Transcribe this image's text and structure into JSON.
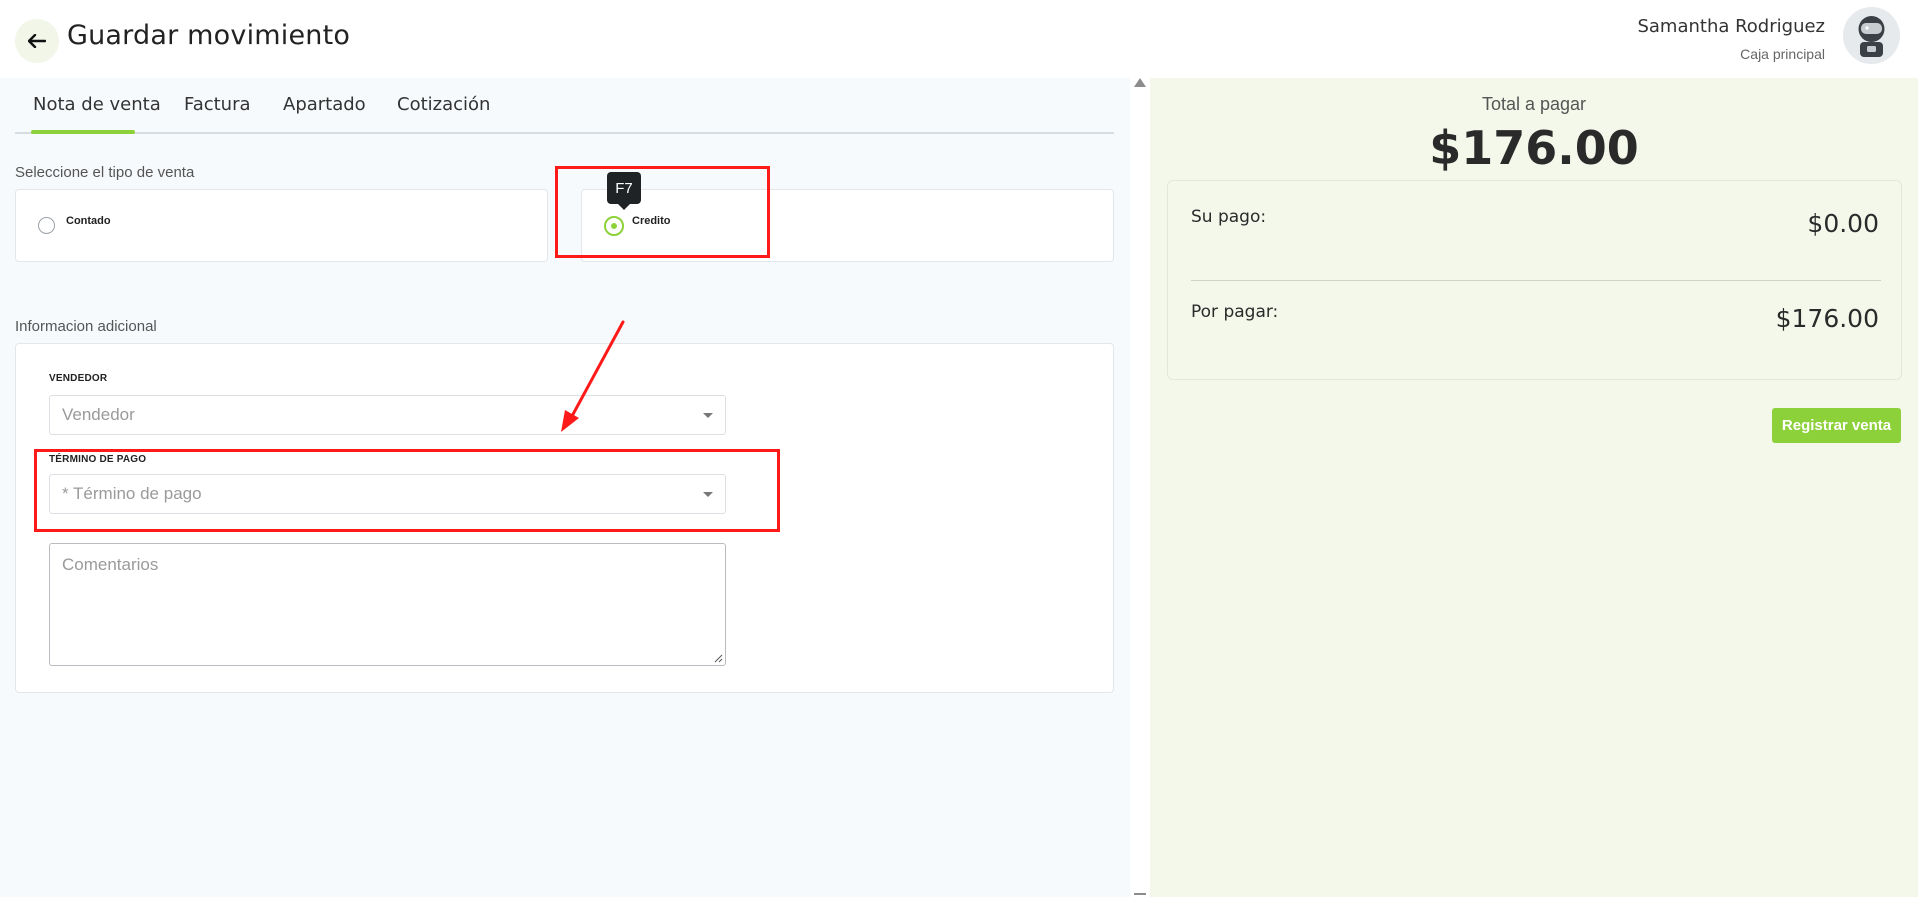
{
  "header": {
    "title": "Guardar movimiento",
    "user_name": "Samantha Rodriguez",
    "user_role": "Caja principal"
  },
  "tabs": [
    {
      "label": "Nota de venta",
      "active": true
    },
    {
      "label": "Factura",
      "active": false
    },
    {
      "label": "Apartado",
      "active": false
    },
    {
      "label": "Cotización",
      "active": false
    }
  ],
  "sale_type": {
    "section_label": "Seleccione el tipo de venta",
    "options": [
      {
        "label": "Contado",
        "selected": false
      },
      {
        "label": "Credito",
        "selected": true
      }
    ],
    "tooltip": "F7"
  },
  "additional_info": {
    "section_label": "Informacion adicional",
    "seller": {
      "label": "VENDEDOR",
      "placeholder": "Vendedor"
    },
    "payment_term": {
      "label": "TÉRMINO DE PAGO",
      "placeholder": "* Término de pago"
    },
    "comments": {
      "placeholder": "Comentarios"
    }
  },
  "summary": {
    "total_label": "Total a pagar",
    "total_value": "$176.00",
    "your_payment_label": "Su pago:",
    "your_payment_value": "$0.00",
    "pending_label": "Por pagar:",
    "pending_value": "$176.00",
    "register_button": "Registrar venta"
  },
  "colors": {
    "accent": "#8dd13a",
    "annotation": "#ff1a1a",
    "summary_bg": "#f3f8ea"
  },
  "icons": {
    "back": "arrow-left-icon",
    "avatar": "astronaut-avatar-icon",
    "dropdown": "caret-down-icon"
  }
}
